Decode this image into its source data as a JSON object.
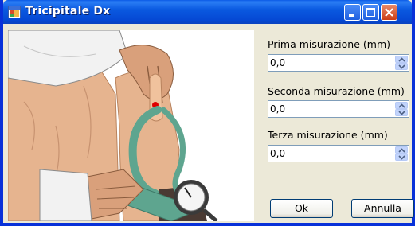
{
  "window": {
    "title": "Tricipitale Dx"
  },
  "fields": [
    {
      "label": "Prima misurazione (mm)",
      "value": "0,0"
    },
    {
      "label": "Seconda misurazione (mm)",
      "value": "0,0"
    },
    {
      "label": "Terza misurazione (mm)",
      "value": "0,0"
    }
  ],
  "buttons": {
    "ok": "Ok",
    "cancel": "Annulla"
  },
  "icons": {
    "app": "app-window-icon",
    "minimize": "minimize-icon",
    "maximize": "maximize-icon",
    "close": "close-icon",
    "spin_up": "chevron-up-icon",
    "spin_down": "chevron-down-icon"
  },
  "colors": {
    "titlebar": "#0a5ae6",
    "close": "#cc3d16",
    "caliper": "#5ea58f",
    "marker": "#e00000"
  }
}
